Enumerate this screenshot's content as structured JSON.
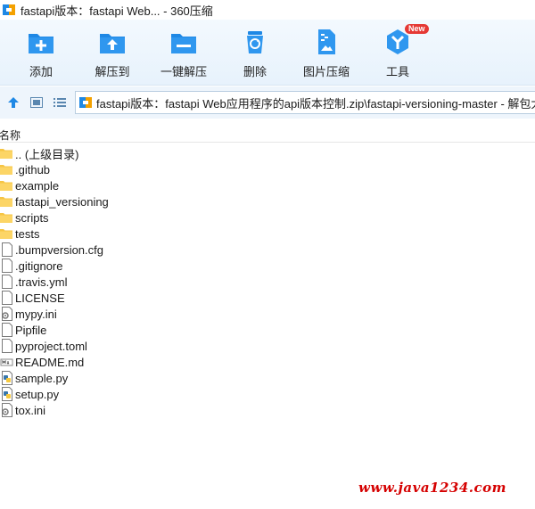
{
  "window": {
    "title": "fastapi版本：fastapi Web... - 360压缩"
  },
  "toolbar": {
    "add_label": "添加",
    "extract_to_label": "解压到",
    "one_click_extract_label": "一键解压",
    "delete_label": "删除",
    "image_compress_label": "图片压缩",
    "tools_label": "工具",
    "tools_badge": "New"
  },
  "address": {
    "path": "fastapi版本：fastapi Web应用程序的api版本控制.zip\\fastapi-versioning-master - 解包大"
  },
  "columns": {
    "name": "名称"
  },
  "files": [
    {
      "name": ".. (上级目录)",
      "icon": "folder-icon"
    },
    {
      "name": ".github",
      "icon": "folder-icon"
    },
    {
      "name": "example",
      "icon": "folder-icon"
    },
    {
      "name": "fastapi_versioning",
      "icon": "folder-icon"
    },
    {
      "name": "scripts",
      "icon": "folder-icon"
    },
    {
      "name": "tests",
      "icon": "folder-icon"
    },
    {
      "name": ".bumpversion.cfg",
      "icon": "file-icon"
    },
    {
      "name": ".gitignore",
      "icon": "file-icon"
    },
    {
      "name": ".travis.yml",
      "icon": "file-icon"
    },
    {
      "name": "LICENSE",
      "icon": "file-icon"
    },
    {
      "name": "mypy.ini",
      "icon": "settings-file-icon"
    },
    {
      "name": "Pipfile",
      "icon": "file-icon"
    },
    {
      "name": "pyproject.toml",
      "icon": "file-icon"
    },
    {
      "name": "README.md",
      "icon": "markdown-file-icon"
    },
    {
      "name": "sample.py",
      "icon": "python-file-icon"
    },
    {
      "name": "setup.py",
      "icon": "python-file-icon"
    },
    {
      "name": "tox.ini",
      "icon": "settings-file-icon"
    }
  ],
  "watermark": "www.java1234.com",
  "colors": {
    "accent": "#1e88e5",
    "folder": "#f6c544",
    "watermark": "#d50000",
    "badge": "#e53935"
  }
}
